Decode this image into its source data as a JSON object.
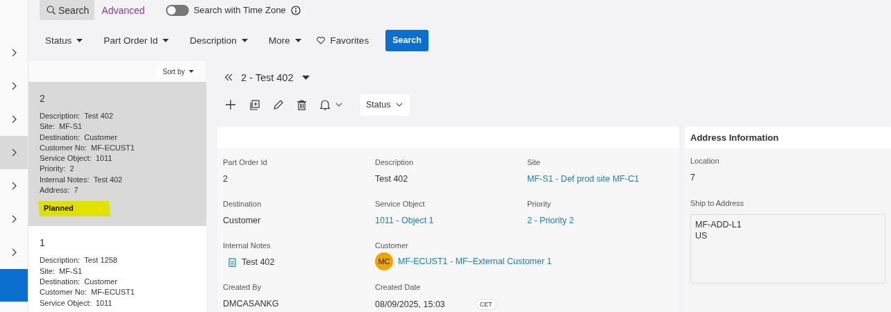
{
  "nav_rail": {
    "items": [
      {
        "selected": false
      },
      {
        "selected": false
      },
      {
        "selected": false
      },
      {
        "selected": true
      },
      {
        "selected": false
      },
      {
        "selected": false
      },
      {
        "selected": false
      }
    ]
  },
  "search_bar": {
    "tabs": [
      {
        "label": "Search",
        "selected": true
      },
      {
        "label": "Advanced",
        "selected": false
      }
    ],
    "time_zone_toggle": {
      "label": "Search with Time Zone",
      "on": false
    }
  },
  "filter_bar": {
    "filters": [
      {
        "label": "Status"
      },
      {
        "label": "Part Order Id"
      },
      {
        "label": "Description"
      },
      {
        "label": "More"
      }
    ],
    "favorites": "Favorites",
    "search_button": "Search"
  },
  "record_list": {
    "sort_label": "Sort by",
    "records": [
      {
        "id": "2",
        "selected": true,
        "fields": [
          {
            "label": "Description:",
            "value": "Test 402"
          },
          {
            "label": "Site:",
            "value": "MF-S1"
          },
          {
            "label": "Destination:",
            "value": "Customer"
          },
          {
            "label": "Customer No:",
            "value": "MF-ECUST1"
          },
          {
            "label": "Service Object:",
            "value": "1011"
          },
          {
            "label": "Priority:",
            "value": "2"
          },
          {
            "label": "Internal Notes:",
            "value": "Test 402"
          },
          {
            "label": "Address:",
            "value": "7"
          }
        ],
        "status": "Planned"
      },
      {
        "id": "1",
        "selected": false,
        "fields": [
          {
            "label": "Description:",
            "value": "Test 1258"
          },
          {
            "label": "Site:",
            "value": "MF-S1"
          },
          {
            "label": "Destination:",
            "value": "Customer"
          },
          {
            "label": "Customer No:",
            "value": "MF-ECUST1"
          },
          {
            "label": "Service Object:",
            "value": "1011"
          }
        ]
      }
    ]
  },
  "detail": {
    "title": "2 - Test 402",
    "status_menu": "Status",
    "main_card": {
      "rows": [
        [
          {
            "label": "Part Order Id",
            "value": "2",
            "kind": "text"
          },
          {
            "label": "Description",
            "value": "Test 402",
            "kind": "text"
          },
          {
            "label": "Site",
            "value": "MF-S1 - Def prod site MF-C1",
            "kind": "link"
          }
        ],
        [
          {
            "label": "Destination",
            "value": "Customer",
            "kind": "text"
          },
          {
            "label": "Service Object",
            "value": "1011 - Object 1",
            "kind": "link"
          },
          {
            "label": "Priority",
            "value": "2 - Priority 2",
            "kind": "link"
          }
        ],
        [
          {
            "label": "Internal Notes",
            "value": "Test 402",
            "kind": "note"
          },
          {
            "label": "Customer",
            "value": "MF-ECUST1 - MF–External Customer 1",
            "kind": "customer",
            "initials": "MC"
          }
        ],
        [
          {
            "label": "Created By",
            "value": "DMCASANKG",
            "kind": "text"
          },
          {
            "label": "Created Date",
            "value": "08/09/2025, 15:03",
            "kind": "datetime",
            "zone": "CET"
          }
        ]
      ]
    },
    "address_card": {
      "title": "Address Information",
      "location_label": "Location",
      "location": "7",
      "ship_label": "Ship to Address",
      "ship_lines": [
        "MF-ADD-L1",
        "US"
      ]
    }
  }
}
